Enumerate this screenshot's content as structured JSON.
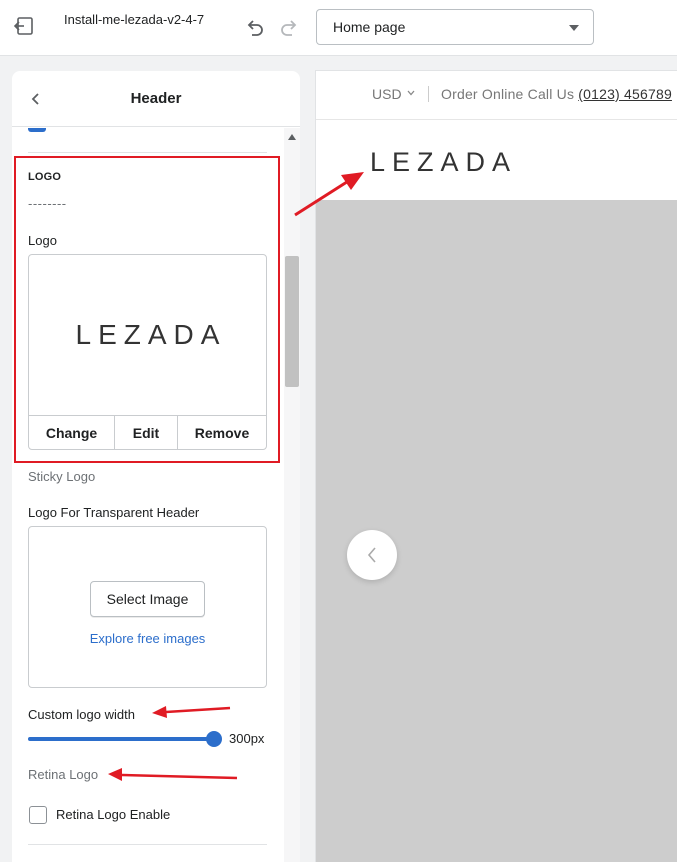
{
  "topbar": {
    "theme_name": "Install-me-lezada-v2-4-7",
    "page_selector": "Home page",
    "icons": [
      "exit-icon",
      "undo-icon",
      "redo-icon",
      "chevron-down-icon"
    ]
  },
  "sidebar": {
    "title": "Header",
    "logo_section": {
      "heading": "LOGO",
      "divider_text": "--------",
      "logo_label": "Logo",
      "logo_text": "LEZADA",
      "actions": {
        "change": "Change",
        "edit": "Edit",
        "remove": "Remove"
      }
    },
    "sticky_logo_label": "Sticky Logo",
    "transparent_logo": {
      "label": "Logo For Transparent Header",
      "select_button": "Select Image",
      "explore_link": "Explore free images"
    },
    "custom_logo_width": {
      "label": "Custom logo width",
      "value": "300px",
      "slider_fraction": 1.0
    },
    "retina_logo_label": "Retina Logo",
    "retina_checkbox": {
      "label": "Retina Logo Enable",
      "checked": false
    }
  },
  "preview": {
    "currency": "USD",
    "order_text": "Order Online Call Us",
    "phone": "(0123) 456789",
    "logo_text": "LEZADA"
  },
  "colors": {
    "accent": "#2c6ecb",
    "highlight": "#e01b24",
    "banner": "#cdcdcd"
  }
}
